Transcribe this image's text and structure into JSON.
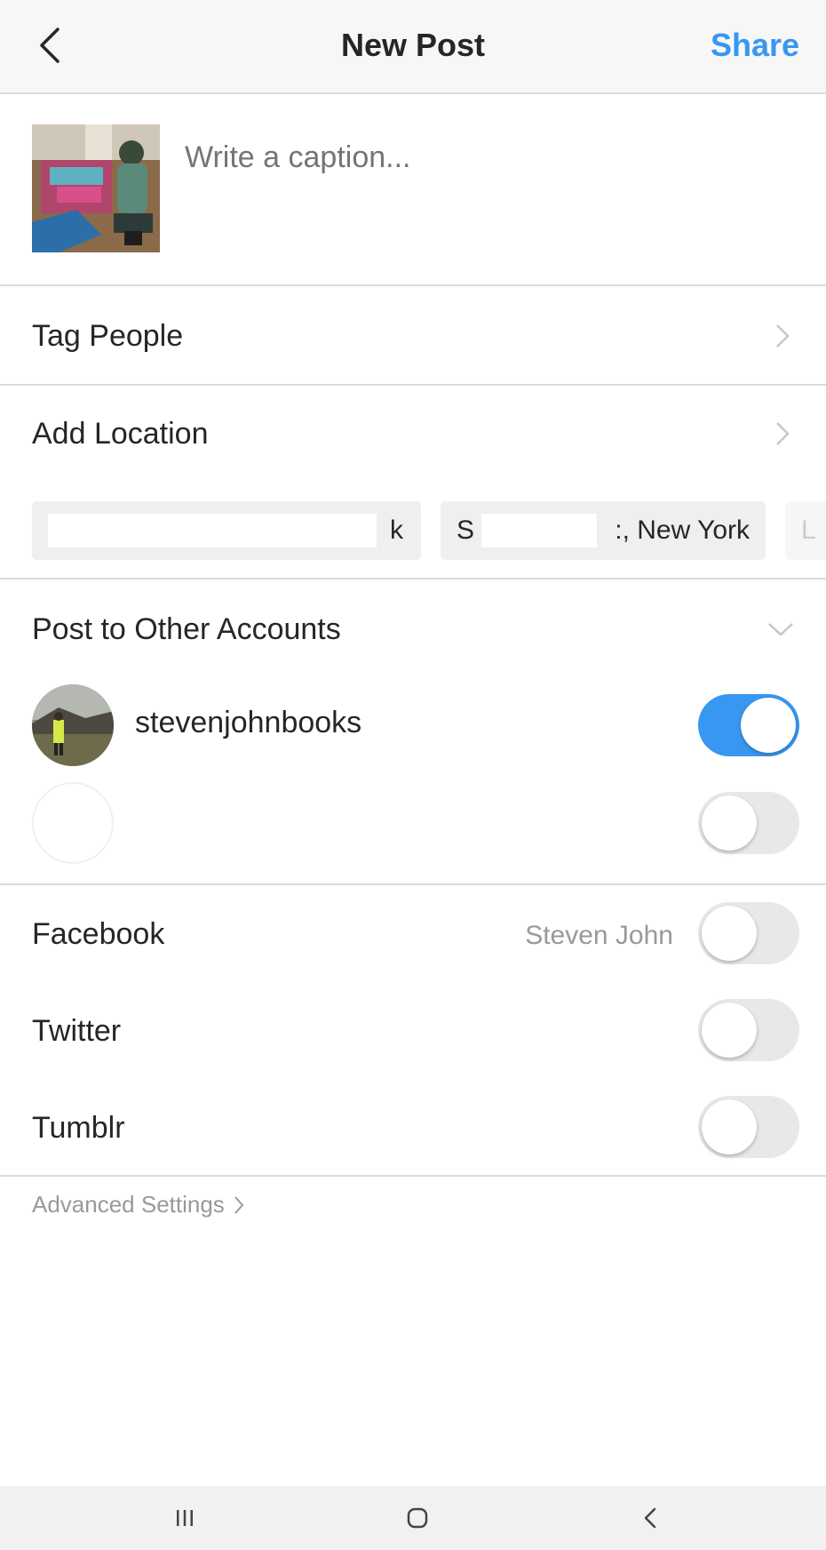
{
  "header": {
    "title": "New Post",
    "share_label": "Share"
  },
  "caption": {
    "placeholder": "Write a caption..."
  },
  "rows": {
    "tag_people": "Tag People",
    "add_location": "Add Location"
  },
  "location_chips": [
    {
      "visible_text": "k"
    },
    {
      "prefix": "S",
      "suffix": ":, New York"
    },
    {
      "visible_text": "L"
    }
  ],
  "other_accounts": {
    "header": "Post to Other Accounts",
    "accounts": [
      {
        "name": "stevenjohnbooks",
        "enabled": true
      },
      {
        "name": "",
        "enabled": false
      }
    ]
  },
  "share_targets": [
    {
      "label": "Facebook",
      "user": "Steven John",
      "enabled": false
    },
    {
      "label": "Twitter",
      "enabled": false
    },
    {
      "label": "Tumblr",
      "enabled": false
    }
  ],
  "advanced_settings_label": "Advanced Settings",
  "colors": {
    "accent": "#3897f0",
    "divider": "#dbdbdb",
    "muted_text": "#999999"
  },
  "icons": {
    "back": "chevron-left-icon",
    "row": "chevron-right-icon",
    "expand": "chevron-down-icon",
    "nav_recents": "recents-icon",
    "nav_home": "home-icon",
    "nav_back": "back-icon"
  }
}
